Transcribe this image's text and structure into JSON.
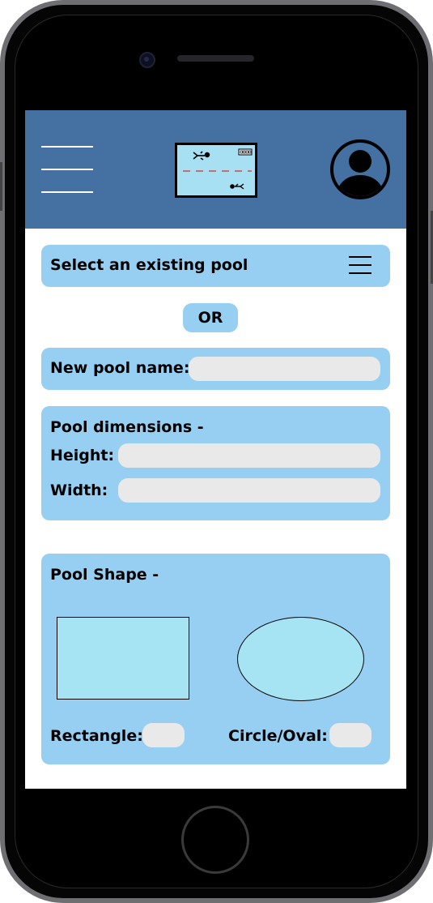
{
  "header": {
    "menu_icon": "hamburger-menu-icon",
    "logo_icon": "swimming-pool-logo-icon",
    "profile_icon": "user-profile-icon",
    "color": "#4570a2"
  },
  "select_pool": {
    "label": "Select an existing pool",
    "menu_icon": "list-menu-icon"
  },
  "or_label": "OR",
  "new_pool": {
    "label": "New pool name:",
    "value": ""
  },
  "dimensions": {
    "title": "Pool dimensions -",
    "height_label": "Height:",
    "height_value": "",
    "width_label": "Width:",
    "width_value": ""
  },
  "shape": {
    "title": "Pool Shape -",
    "rectangle_label": "Rectangle:",
    "rectangle_value": "",
    "oval_label": "Circle/Oval:",
    "oval_value": ""
  },
  "colors": {
    "card": "#96cff1",
    "field": "#e9e9e9",
    "shape_fill": "#a6e3f3"
  }
}
